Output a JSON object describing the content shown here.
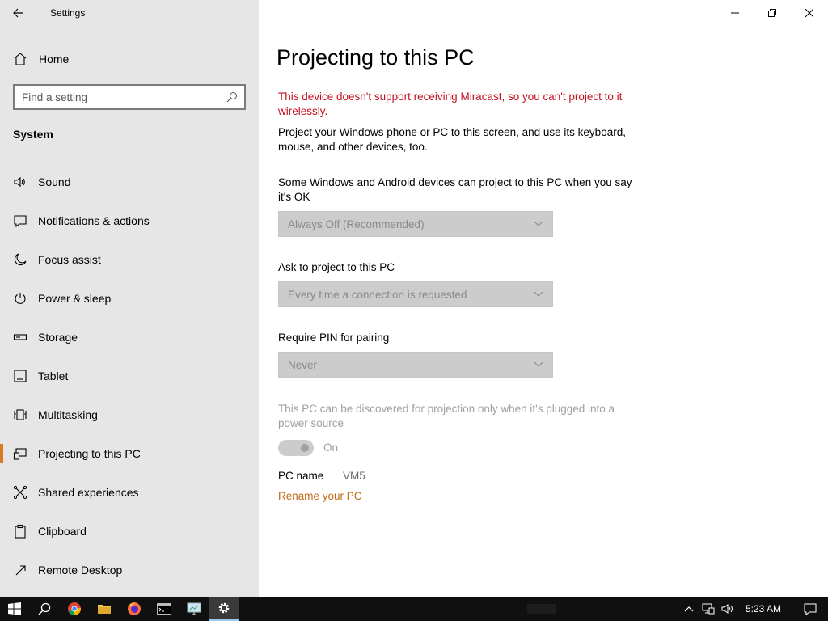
{
  "window": {
    "title": "Settings"
  },
  "sidebar": {
    "home_label": "Home",
    "search_placeholder": "Find a setting",
    "section": "System",
    "items": [
      {
        "label": "Sound",
        "icon": "speaker-icon"
      },
      {
        "label": "Notifications & actions",
        "icon": "message-icon"
      },
      {
        "label": "Focus assist",
        "icon": "moon-icon"
      },
      {
        "label": "Power & sleep",
        "icon": "power-icon"
      },
      {
        "label": "Storage",
        "icon": "storage-icon"
      },
      {
        "label": "Tablet",
        "icon": "tablet-icon"
      },
      {
        "label": "Multitasking",
        "icon": "multitasking-icon"
      },
      {
        "label": "Projecting to this PC",
        "icon": "projecting-icon",
        "active": true
      },
      {
        "label": "Shared experiences",
        "icon": "shared-icon"
      },
      {
        "label": "Clipboard",
        "icon": "clipboard-icon"
      },
      {
        "label": "Remote Desktop",
        "icon": "remote-desktop-icon"
      }
    ]
  },
  "main": {
    "title": "Projecting to this PC",
    "warning": "This device doesn't support receiving Miracast, so you can't project to it wirelessly.",
    "description": "Project your Windows phone or PC to this screen, and use its keyboard, mouse, and other devices, too.",
    "setting1": {
      "label": "Some Windows and Android devices can project to this PC when you say it's OK",
      "value": "Always Off (Recommended)"
    },
    "setting2": {
      "label": "Ask to project to this PC",
      "value": "Every time a connection is requested"
    },
    "setting3": {
      "label": "Require PIN for pairing",
      "value": "Never"
    },
    "power_setting": {
      "label": "This PC can be discovered for projection only when it's plugged into a power source",
      "toggle_state": "On"
    },
    "pc_name_label": "PC name",
    "pc_name_value": "VM5",
    "rename_link": "Rename your PC"
  },
  "taskbar": {
    "clock": "5:23 AM",
    "apps": [
      "start-icon",
      "search-icon",
      "chrome-icon",
      "file-explorer-icon",
      "firefox-icon",
      "cmd-icon",
      "remote-desktop-app-icon",
      "settings-icon"
    ]
  },
  "colors": {
    "accent": "#d67b22",
    "warning": "#c50f1f",
    "link": "#c26a12",
    "sidebar_bg": "#e6e6e6",
    "taskbar_bg": "#101010"
  }
}
